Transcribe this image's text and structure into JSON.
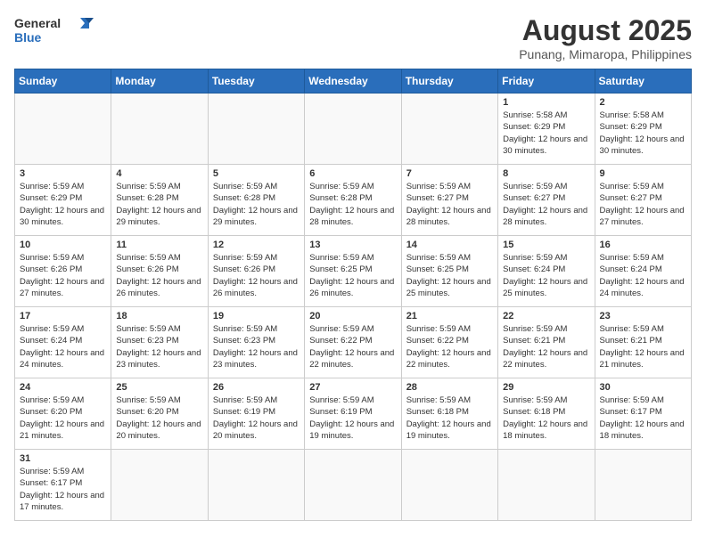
{
  "header": {
    "logo_general": "General",
    "logo_blue": "Blue",
    "month_year": "August 2025",
    "location": "Punang, Mimaropa, Philippines"
  },
  "weekdays": [
    "Sunday",
    "Monday",
    "Tuesday",
    "Wednesday",
    "Thursday",
    "Friday",
    "Saturday"
  ],
  "weeks": [
    [
      {
        "day": "",
        "info": ""
      },
      {
        "day": "",
        "info": ""
      },
      {
        "day": "",
        "info": ""
      },
      {
        "day": "",
        "info": ""
      },
      {
        "day": "",
        "info": ""
      },
      {
        "day": "1",
        "info": "Sunrise: 5:58 AM\nSunset: 6:29 PM\nDaylight: 12 hours and 30 minutes."
      },
      {
        "day": "2",
        "info": "Sunrise: 5:58 AM\nSunset: 6:29 PM\nDaylight: 12 hours and 30 minutes."
      }
    ],
    [
      {
        "day": "3",
        "info": "Sunrise: 5:59 AM\nSunset: 6:29 PM\nDaylight: 12 hours and 30 minutes."
      },
      {
        "day": "4",
        "info": "Sunrise: 5:59 AM\nSunset: 6:28 PM\nDaylight: 12 hours and 29 minutes."
      },
      {
        "day": "5",
        "info": "Sunrise: 5:59 AM\nSunset: 6:28 PM\nDaylight: 12 hours and 29 minutes."
      },
      {
        "day": "6",
        "info": "Sunrise: 5:59 AM\nSunset: 6:28 PM\nDaylight: 12 hours and 28 minutes."
      },
      {
        "day": "7",
        "info": "Sunrise: 5:59 AM\nSunset: 6:27 PM\nDaylight: 12 hours and 28 minutes."
      },
      {
        "day": "8",
        "info": "Sunrise: 5:59 AM\nSunset: 6:27 PM\nDaylight: 12 hours and 28 minutes."
      },
      {
        "day": "9",
        "info": "Sunrise: 5:59 AM\nSunset: 6:27 PM\nDaylight: 12 hours and 27 minutes."
      }
    ],
    [
      {
        "day": "10",
        "info": "Sunrise: 5:59 AM\nSunset: 6:26 PM\nDaylight: 12 hours and 27 minutes."
      },
      {
        "day": "11",
        "info": "Sunrise: 5:59 AM\nSunset: 6:26 PM\nDaylight: 12 hours and 26 minutes."
      },
      {
        "day": "12",
        "info": "Sunrise: 5:59 AM\nSunset: 6:26 PM\nDaylight: 12 hours and 26 minutes."
      },
      {
        "day": "13",
        "info": "Sunrise: 5:59 AM\nSunset: 6:25 PM\nDaylight: 12 hours and 26 minutes."
      },
      {
        "day": "14",
        "info": "Sunrise: 5:59 AM\nSunset: 6:25 PM\nDaylight: 12 hours and 25 minutes."
      },
      {
        "day": "15",
        "info": "Sunrise: 5:59 AM\nSunset: 6:24 PM\nDaylight: 12 hours and 25 minutes."
      },
      {
        "day": "16",
        "info": "Sunrise: 5:59 AM\nSunset: 6:24 PM\nDaylight: 12 hours and 24 minutes."
      }
    ],
    [
      {
        "day": "17",
        "info": "Sunrise: 5:59 AM\nSunset: 6:24 PM\nDaylight: 12 hours and 24 minutes."
      },
      {
        "day": "18",
        "info": "Sunrise: 5:59 AM\nSunset: 6:23 PM\nDaylight: 12 hours and 23 minutes."
      },
      {
        "day": "19",
        "info": "Sunrise: 5:59 AM\nSunset: 6:23 PM\nDaylight: 12 hours and 23 minutes."
      },
      {
        "day": "20",
        "info": "Sunrise: 5:59 AM\nSunset: 6:22 PM\nDaylight: 12 hours and 22 minutes."
      },
      {
        "day": "21",
        "info": "Sunrise: 5:59 AM\nSunset: 6:22 PM\nDaylight: 12 hours and 22 minutes."
      },
      {
        "day": "22",
        "info": "Sunrise: 5:59 AM\nSunset: 6:21 PM\nDaylight: 12 hours and 22 minutes."
      },
      {
        "day": "23",
        "info": "Sunrise: 5:59 AM\nSunset: 6:21 PM\nDaylight: 12 hours and 21 minutes."
      }
    ],
    [
      {
        "day": "24",
        "info": "Sunrise: 5:59 AM\nSunset: 6:20 PM\nDaylight: 12 hours and 21 minutes."
      },
      {
        "day": "25",
        "info": "Sunrise: 5:59 AM\nSunset: 6:20 PM\nDaylight: 12 hours and 20 minutes."
      },
      {
        "day": "26",
        "info": "Sunrise: 5:59 AM\nSunset: 6:19 PM\nDaylight: 12 hours and 20 minutes."
      },
      {
        "day": "27",
        "info": "Sunrise: 5:59 AM\nSunset: 6:19 PM\nDaylight: 12 hours and 19 minutes."
      },
      {
        "day": "28",
        "info": "Sunrise: 5:59 AM\nSunset: 6:18 PM\nDaylight: 12 hours and 19 minutes."
      },
      {
        "day": "29",
        "info": "Sunrise: 5:59 AM\nSunset: 6:18 PM\nDaylight: 12 hours and 18 minutes."
      },
      {
        "day": "30",
        "info": "Sunrise: 5:59 AM\nSunset: 6:17 PM\nDaylight: 12 hours and 18 minutes."
      }
    ],
    [
      {
        "day": "31",
        "info": "Sunrise: 5:59 AM\nSunset: 6:17 PM\nDaylight: 12 hours and 17 minutes."
      },
      {
        "day": "",
        "info": ""
      },
      {
        "day": "",
        "info": ""
      },
      {
        "day": "",
        "info": ""
      },
      {
        "day": "",
        "info": ""
      },
      {
        "day": "",
        "info": ""
      },
      {
        "day": "",
        "info": ""
      }
    ]
  ]
}
